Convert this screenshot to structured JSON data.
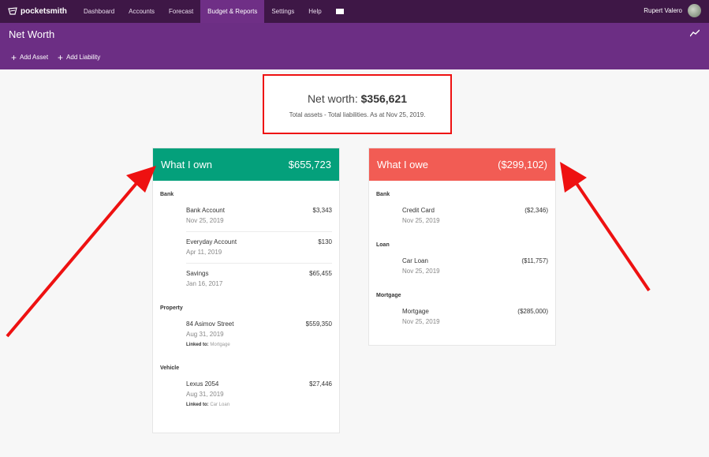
{
  "nav": {
    "brand": "pocketsmith",
    "items": [
      {
        "label": "Dashboard"
      },
      {
        "label": "Accounts"
      },
      {
        "label": "Forecast"
      },
      {
        "label": "Budget & Reports"
      },
      {
        "label": "Settings"
      },
      {
        "label": "Help"
      }
    ],
    "user_name": "Rupert Valero"
  },
  "header": {
    "title": "Net Worth",
    "add_asset": "Add Asset",
    "add_liability": "Add Liability"
  },
  "summary": {
    "label": "Net worth:",
    "value": "$356,621",
    "note": "Total assets - Total liabilities. As at Nov 25, 2019."
  },
  "own": {
    "title": "What I own",
    "total": "$655,723",
    "groups": [
      {
        "label": "Bank",
        "accounts": [
          {
            "name": "Bank Account",
            "date": "Nov 25, 2019",
            "amount": "$3,343"
          },
          {
            "name": "Everyday Account",
            "date": "Apr 11, 2019",
            "amount": "$130"
          },
          {
            "name": "Savings",
            "date": "Jan 16, 2017",
            "amount": "$65,455"
          }
        ]
      },
      {
        "label": "Property",
        "accounts": [
          {
            "name": "84 Asimov Street",
            "date": "Aug 31, 2019",
            "amount": "$559,350",
            "linked_label": "Linked to:",
            "linked_to": "Mortgage"
          }
        ]
      },
      {
        "label": "Vehicle",
        "accounts": [
          {
            "name": "Lexus 2054",
            "date": "Aug 31, 2019",
            "amount": "$27,446",
            "linked_label": "Linked to:",
            "linked_to": "Car Loan"
          }
        ]
      }
    ]
  },
  "owe": {
    "title": "What I owe",
    "total": "($299,102)",
    "groups": [
      {
        "label": "Bank",
        "accounts": [
          {
            "name": "Credit Card",
            "date": "Nov 25, 2019",
            "amount": "($2,346)"
          }
        ]
      },
      {
        "label": "Loan",
        "accounts": [
          {
            "name": "Car Loan",
            "date": "Nov 25, 2019",
            "amount": "($11,757)"
          }
        ]
      },
      {
        "label": "Mortgage",
        "accounts": [
          {
            "name": "Mortgage",
            "date": "Nov 25, 2019",
            "amount": "($285,000)"
          }
        ]
      }
    ]
  },
  "colors": {
    "nav_bg": "#3e1746",
    "header_bg": "#6c2e84",
    "own_accent": "#04a07b",
    "owe_accent": "#f25c54",
    "annotation": "#ee1111"
  }
}
